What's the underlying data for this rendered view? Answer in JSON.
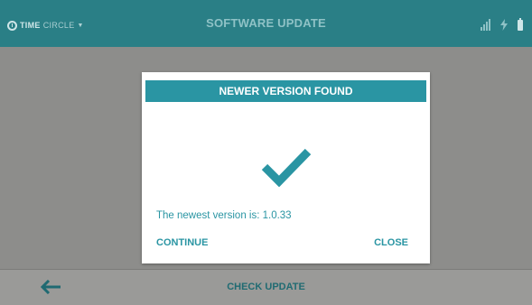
{
  "header": {
    "logo_text": "TIME",
    "logo_sub": "CIRCLE",
    "title": "SOFTWARE UPDATE"
  },
  "dialog": {
    "title": "NEWER VERSION FOUND",
    "status_icon": "checkmark-icon",
    "version_text": "The newest version is: 1.0.33",
    "continue_label": "CONTINUE",
    "close_label": "CLOSE"
  },
  "footer": {
    "back_icon": "back-arrow-icon",
    "check_update_label": "CHECK UPDATE"
  },
  "colors": {
    "header_bg": "#2a7f86",
    "accent": "#2a95a3",
    "overlay": "#8d8d8b"
  }
}
